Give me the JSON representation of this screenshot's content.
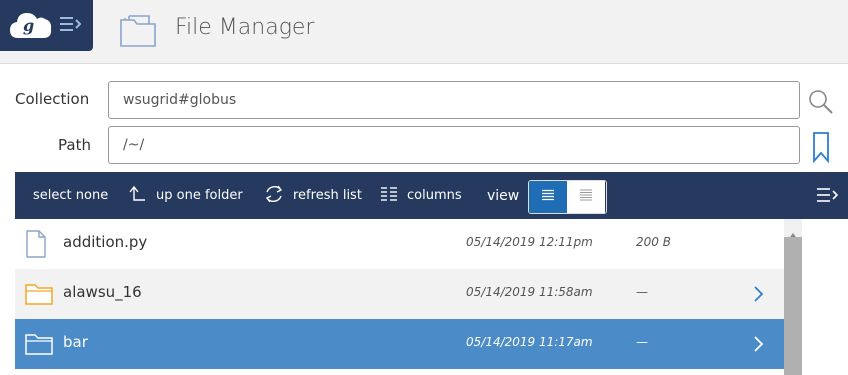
{
  "header": {
    "title": "File Manager",
    "logo_icon": "globus-cloud-logo",
    "menu_icon": "menu-expand-icon",
    "page_icon": "file-manager-icon"
  },
  "collection": {
    "label": "Collection",
    "value": "wsugrid#globus"
  },
  "path": {
    "label": "Path",
    "value": "/~/"
  },
  "toolbar": {
    "select_none": "select none",
    "up_one_folder": "up one folder",
    "refresh_list": "refresh list",
    "columns": "columns",
    "view": "view"
  },
  "files": [
    {
      "name": "addition.py",
      "date": "05/14/2019 12:11pm",
      "size": "200 B",
      "type": "file"
    },
    {
      "name": "alawsu_16",
      "date": "05/14/2019 11:58am",
      "size": "—",
      "type": "folder"
    },
    {
      "name": "bar",
      "date": "05/14/2019 11:17am",
      "size": "—",
      "type": "folder",
      "selected": true
    }
  ],
  "colors": {
    "navy": "#26395f",
    "accent_blue": "#1f6db5",
    "selected_row": "#4b8cc8",
    "folder_orange": "#f5a623"
  }
}
